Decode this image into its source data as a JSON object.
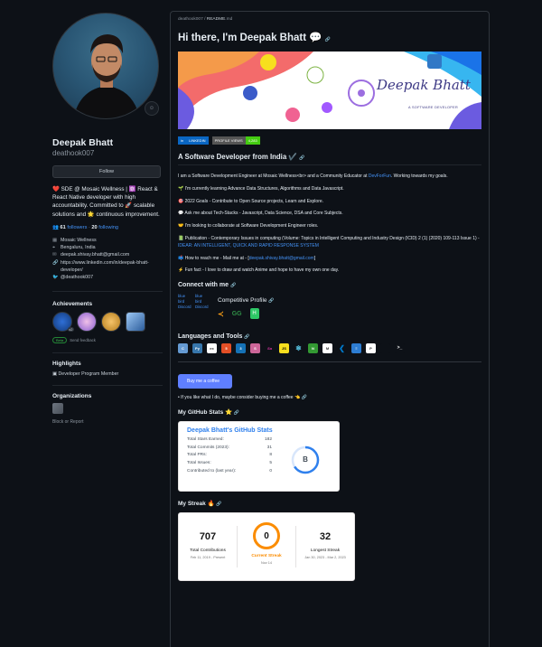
{
  "profile": {
    "name": "Deepak Bhatt",
    "login": "deathook007",
    "follow_label": "Follow",
    "bio": "❤️ SDE @ Mosaic Wellness | ⚛️ React & React Native developer with high accountability. Committed to 🚀 scalable solutions and 🌟 continuous improvement.",
    "followers_count": "61",
    "followers_label": "followers",
    "following_count": "20",
    "following_label": "following",
    "details": [
      {
        "icon": "organization-icon",
        "text": "Mosaic Wellness"
      },
      {
        "icon": "location-icon",
        "text": "Bengaluru, India"
      },
      {
        "icon": "mail-icon",
        "text": "deepak.shivay.bhatt@gmail.com"
      },
      {
        "icon": "link-icon",
        "text": "https://www.linkedin.com/in/deepak-bhatt-developer/"
      },
      {
        "icon": "twitter-icon",
        "text": "@deathook007"
      }
    ]
  },
  "achievements": {
    "title": "Achievements",
    "badge_count": "x2",
    "beta_label": "Beta",
    "feedback_label": "Send feedback"
  },
  "highlights": {
    "title": "Highlights",
    "item": "Developer Program Member"
  },
  "organizations": {
    "title": "Organizations"
  },
  "block_label": "Block or Report",
  "readme": {
    "breadcrumb_user": "deathook007",
    "breadcrumb_sep": " / ",
    "breadcrumb_file": "README",
    "breadcrumb_ext": ".md",
    "greeting": "Hi there, I'm Deepak Bhatt 💬",
    "banner_name": "Deepak Bhatt",
    "banner_tag": "A SOFTWARE DEVELOPER",
    "linkedin_badge": "LINKEDIN",
    "views_badge_label": "PROFILE VIEWS",
    "views_badge_value": "4,283",
    "subtitle": "A Software Developer from India ✔️",
    "paragraphs": [
      "I am a Software Development Engineer at Mosaic Wellness<br> and a Community Educator at",
      "🌱 I'm currently learning Advance Data Structures, Algorithms and Data Javascript.",
      "🎯 2022 Goals - Contribute to Open Source projects, Learn and Explore.",
      "💬 Ask me about Tech-Stacks - Javascript, Data Science, DSA and Core Subjects.",
      "🤝 I'm looking to collaborate at Software Development Engineer roles.",
      "📗 Publication - Contemporary Issues in computing (Volume: Topics in Intelligent Computing and Industry Design (ICID) 2 (1) (2020) 109-113 Issue 1) -",
      "📫 How to reach me - Mail me at -",
      "⚡ Fun fact - I love to draw and watch Anime and hope to have my own one day."
    ],
    "devfun_link": "DevForFun",
    "working_towards": ". Working towards my goals.",
    "publication_link": "IDEAR: AN INTELLIGENT, QUICK AND RAPID RESPONSE SYSTEM",
    "mail_link": "deepak.shivay.bhatt@gmail.com",
    "connect_title": "Connect with me",
    "broken_1": "blue bird Discord",
    "broken_2": "blue bird Discord",
    "competitive_title": "Competitive Profile",
    "languages_title": "Languages and Tools",
    "coffee_label": "Buy me a coffee",
    "coffee_note": "If you like what I do, maybe consider buying me a coffee 👈",
    "stats_title": "My GitHub Stats ⭐",
    "streak_title": "My Streak 🔥"
  },
  "github_stats": {
    "title": "Deepak Bhatt's GitHub Stats",
    "rows": [
      {
        "label": "Total Stars Earned:",
        "value": "182"
      },
      {
        "label": "Total Commits (2023):",
        "value": "31"
      },
      {
        "label": "Total PRs:",
        "value": "8"
      },
      {
        "label": "Total Issues:",
        "value": "5"
      },
      {
        "label": "Contributed to (last year):",
        "value": "0"
      }
    ],
    "grade": "B"
  },
  "streak": {
    "total": "707",
    "total_label": "Total Contributions",
    "total_range": "Feb 11, 2019 - Present",
    "current": "0",
    "current_label": "Current Streak",
    "current_date": "Nov 14",
    "longest": "32",
    "longest_label": "Longest Streak",
    "longest_range": "Jan 30, 2023 - Mar 2, 2023"
  },
  "colors": {
    "background": "#0d1117",
    "link": "#4493f8",
    "stats_title": "#2f80ed",
    "streak": "#fb8c00"
  }
}
